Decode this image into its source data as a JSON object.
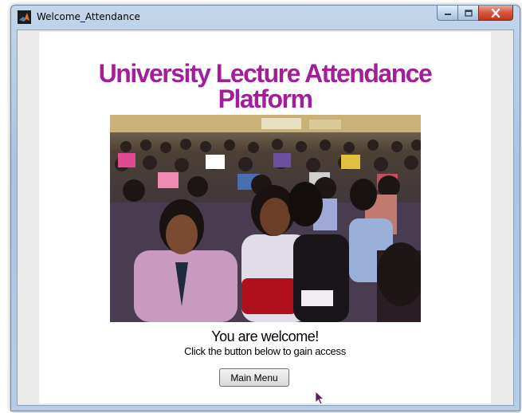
{
  "window": {
    "title": "Welcome_Attendance"
  },
  "content": {
    "heading_line1": "University Lecture Attendance",
    "heading_line2": "Platform",
    "welcome": "You are welcome!",
    "instruction": "Click the button below to gain access",
    "main_menu_label": "Main Menu"
  },
  "icons": {
    "app": "matlab-icon",
    "minimize": "minimize-icon",
    "maximize": "maximize-icon",
    "close": "close-icon",
    "pointer": "mouse-cursor-icon"
  },
  "colors": {
    "heading": "#a31f9a",
    "close_button": "#c7412c"
  }
}
